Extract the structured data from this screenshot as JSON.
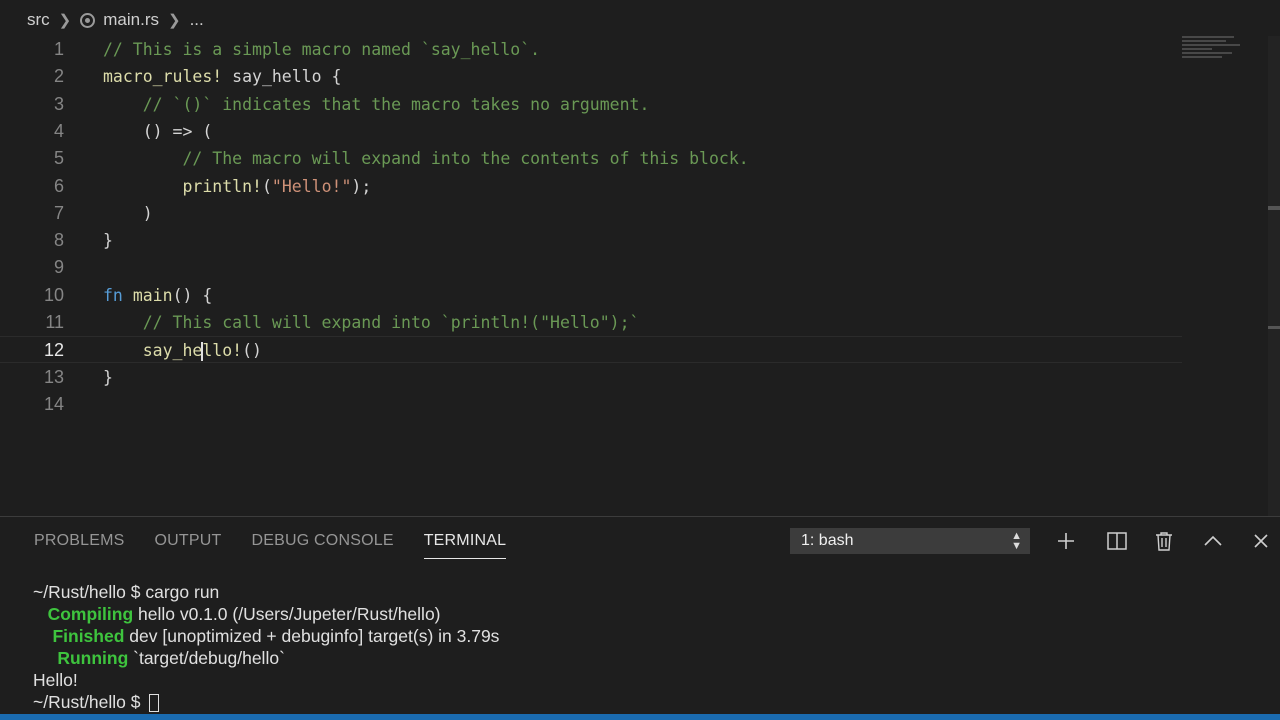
{
  "breadcrumb": {
    "folder": "src",
    "file": "main.rs",
    "more": "..."
  },
  "editor": {
    "lines": [
      {
        "n": "1",
        "tokens": [
          {
            "t": "// This is a simple macro named `say_hello`.",
            "c": "cmt"
          }
        ]
      },
      {
        "n": "2",
        "tokens": [
          {
            "t": "macro_rules! ",
            "c": "mac"
          },
          {
            "t": "say_hello {",
            "c": "plain"
          }
        ]
      },
      {
        "n": "3",
        "tokens": [
          {
            "t": "    ",
            "c": "plain"
          },
          {
            "t": "// `()` indicates that the macro takes no argument.",
            "c": "cmt"
          }
        ]
      },
      {
        "n": "4",
        "tokens": [
          {
            "t": "    () => (",
            "c": "plain"
          }
        ]
      },
      {
        "n": "5",
        "tokens": [
          {
            "t": "        ",
            "c": "plain"
          },
          {
            "t": "// The macro will expand into the contents of this block.",
            "c": "cmt"
          }
        ]
      },
      {
        "n": "6",
        "tokens": [
          {
            "t": "        ",
            "c": "plain"
          },
          {
            "t": "println!",
            "c": "mac"
          },
          {
            "t": "(",
            "c": "plain"
          },
          {
            "t": "\"Hello!\"",
            "c": "str"
          },
          {
            "t": ");",
            "c": "plain"
          }
        ]
      },
      {
        "n": "7",
        "tokens": [
          {
            "t": "    )",
            "c": "plain"
          }
        ]
      },
      {
        "n": "8",
        "tokens": [
          {
            "t": "}",
            "c": "plain"
          }
        ]
      },
      {
        "n": "9",
        "tokens": []
      },
      {
        "n": "10",
        "tokens": [
          {
            "t": "fn ",
            "c": "kw"
          },
          {
            "t": "main",
            "c": "fn"
          },
          {
            "t": "() {",
            "c": "plain"
          }
        ]
      },
      {
        "n": "11",
        "tokens": [
          {
            "t": "    ",
            "c": "plain"
          },
          {
            "t": "// This call will expand into `println!(\"Hello\");`",
            "c": "cmt"
          }
        ]
      },
      {
        "n": "12",
        "tokens": [
          {
            "t": "    ",
            "c": "plain"
          },
          {
            "t": "say_he",
            "c": "mac"
          },
          {
            "t": "CURSOR",
            "c": "cursor"
          },
          {
            "t": "llo!",
            "c": "mac"
          },
          {
            "t": "()",
            "c": "plain"
          }
        ]
      },
      {
        "n": "13",
        "tokens": [
          {
            "t": "}",
            "c": "plain"
          }
        ]
      },
      {
        "n": "14",
        "tokens": []
      }
    ],
    "current_line": "12"
  },
  "panel": {
    "tabs": [
      {
        "label": "PROBLEMS",
        "active": false
      },
      {
        "label": "OUTPUT",
        "active": false
      },
      {
        "label": "DEBUG CONSOLE",
        "active": false
      },
      {
        "label": "TERMINAL",
        "active": true
      }
    ],
    "terminal_select": "1: bash",
    "buttons": [
      "plus-icon",
      "split-icon",
      "trash-icon",
      "chevron-up-icon",
      "close-icon"
    ]
  },
  "terminal": {
    "lines": [
      {
        "prefix": "",
        "green": "",
        "text": "~/Rust/hello $ cargo run"
      },
      {
        "prefix": "   ",
        "green": "Compiling",
        "text": " hello v0.1.0 (/Users/Jupeter/Rust/hello)"
      },
      {
        "prefix": "    ",
        "green": "Finished",
        "text": " dev [unoptimized + debuginfo] target(s) in 3.79s"
      },
      {
        "prefix": "     ",
        "green": "Running",
        "text": " `target/debug/hello`"
      },
      {
        "prefix": "",
        "green": "",
        "text": "Hello!"
      },
      {
        "prefix": "",
        "green": "",
        "text": "~/Rust/hello $ "
      }
    ]
  },
  "colors": {
    "comment": "#6a9955",
    "keyword": "#569cd6",
    "string": "#ce9178",
    "function": "#dcdcaa",
    "terminal_green": "#3ec43e",
    "statusbar": "#1a6bb0"
  }
}
